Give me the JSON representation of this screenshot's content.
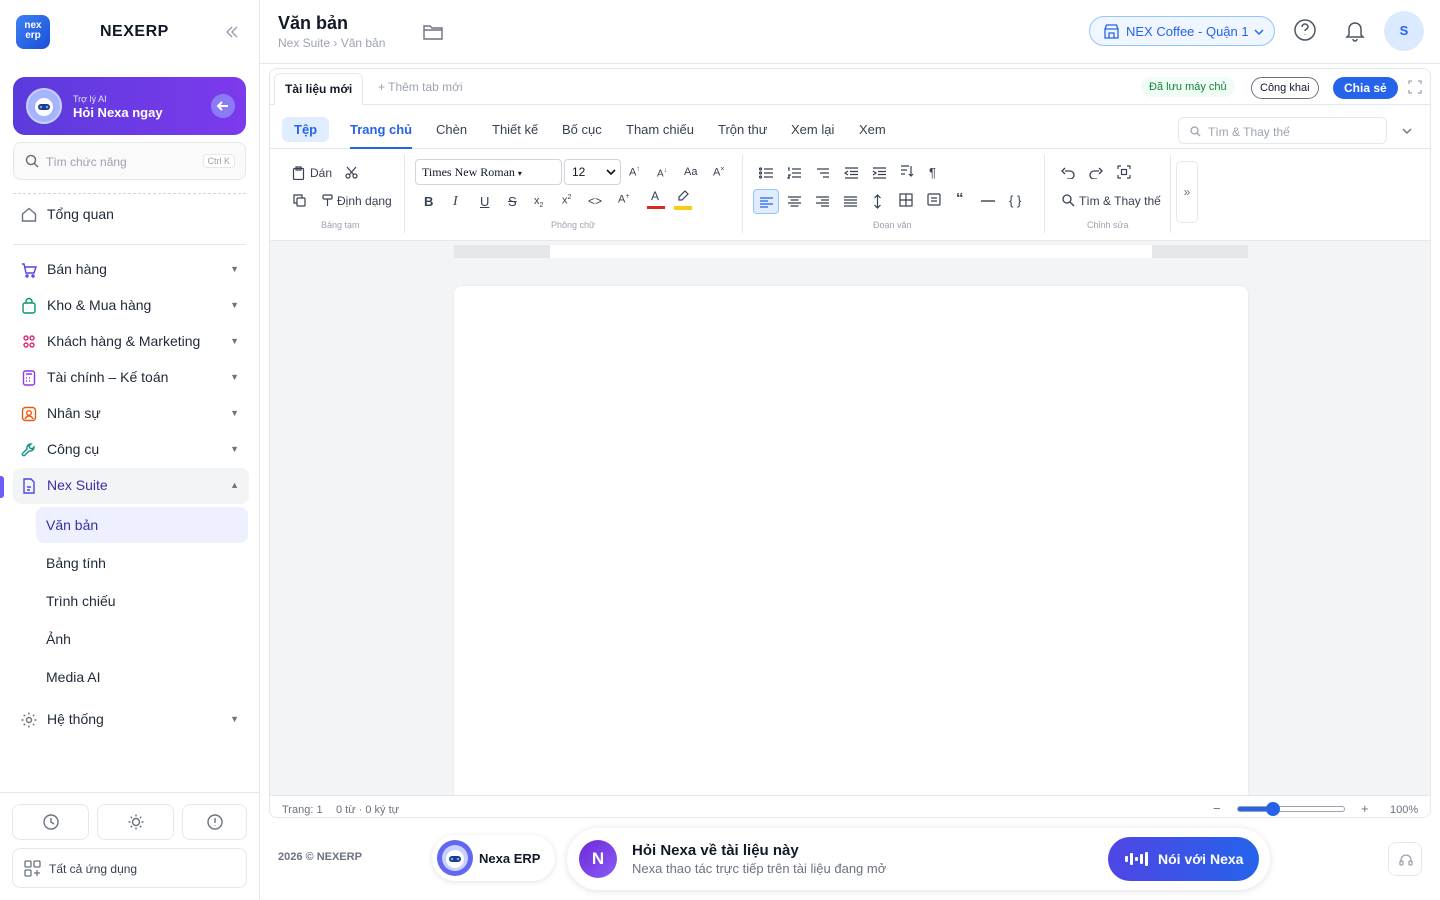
{
  "sidebar": {
    "brand": "NEXERP",
    "logo_text": "nex erp",
    "ai_card": {
      "subtitle": "Trợ lý AI",
      "title": "Hỏi Nexa ngay"
    },
    "search": {
      "placeholder": "Tìm chức năng",
      "shortcut": "Ctrl K"
    },
    "overview": "Tổng quan",
    "items": [
      {
        "label": "Bán hàng",
        "icon": "cart-icon"
      },
      {
        "label": "Kho & Mua hàng",
        "icon": "bag-icon"
      },
      {
        "label": "Khách hàng & Marketing",
        "icon": "people-icon"
      },
      {
        "label": "Tài chính – Kế toán",
        "icon": "calculator-icon"
      },
      {
        "label": "Nhân sự",
        "icon": "user-icon"
      },
      {
        "label": "Công cụ",
        "icon": "wrench-icon"
      },
      {
        "label": "Nex Suite",
        "icon": "document-icon"
      }
    ],
    "suite_sub": [
      "Văn bản",
      "Bảng tính",
      "Trình chiếu",
      "Ảnh",
      "Media AI"
    ],
    "system": "Hệ thống",
    "all_apps": "Tất cả ứng dụng"
  },
  "header": {
    "title": "Văn bản",
    "breadcrumb": "Nex Suite › Văn bản",
    "store": "NEX Coffee - Quận 1",
    "avatar": "S"
  },
  "editor": {
    "tab_active": "Tài liệu mới",
    "tab_new": "+ Thêm tab mới",
    "saved": "Đã lưu máy chủ",
    "public": "Công khai",
    "share": "Chia sẻ",
    "ribbon_tabs": [
      "Tệp",
      "Trang chủ",
      "Chèn",
      "Thiết kế",
      "Bố cục",
      "Tham chiếu",
      "Trộn thư",
      "Xem lại",
      "Xem"
    ],
    "find_placeholder": "Tìm & Thay thế",
    "clipboard": {
      "paste": "Dán",
      "format": "Định dạng",
      "group": "Bảng tạm"
    },
    "font": {
      "family": "Times New Roman",
      "size": "12",
      "group": "Phông chữ"
    },
    "paragraph_group": "Đoạn văn",
    "editing": {
      "find": "Tìm & Thay thế",
      "group": "Chỉnh sửa"
    },
    "status": {
      "page": "Trang: 1",
      "words": "0 từ · 0 ký tự",
      "zoom": "100%",
      "zoom_level": 0.33
    }
  },
  "bottom": {
    "copyright": "2026 © NEXERP",
    "nexa_pill": "Nexa ERP",
    "ask_title": "Hỏi Nexa về tài liệu này",
    "ask_sub": "Nexa thao tác trực tiếp trên tài liệu đang mở",
    "ask_initial": "N",
    "talk": "Nói với Nexa"
  },
  "colors": {
    "accent": "#2563eb",
    "ai_purple": "#6d28d9",
    "font_color": "#dc2626",
    "highlight": "#facc15"
  }
}
